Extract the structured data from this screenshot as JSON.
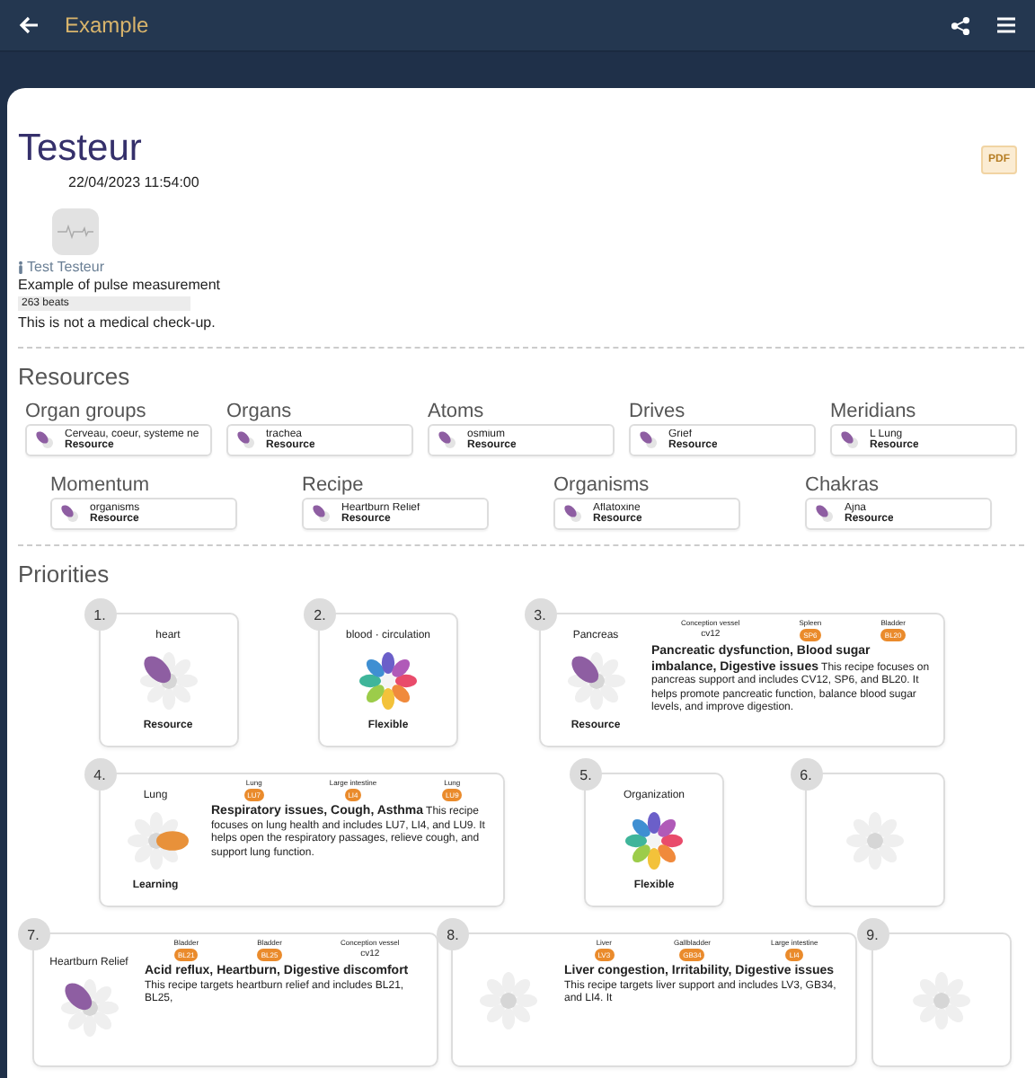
{
  "app_bar": {
    "title": "Example"
  },
  "report": {
    "title": "Testeur",
    "pdf_label": "PDF",
    "date": "22/04/2023 11:54:00",
    "person": "Test Testeur",
    "description": "Example of pulse measurement",
    "reading": "263 beats",
    "disclaimer": "This is not a medical check-up."
  },
  "resources": {
    "heading": "Resources",
    "groups": [
      {
        "name": "Organ groups",
        "item": "Cerveau, coeur, systeme ne",
        "type": "Resource"
      },
      {
        "name": "Organs",
        "item": "trachea",
        "type": "Resource"
      },
      {
        "name": "Atoms",
        "item": "osmium",
        "type": "Resource"
      },
      {
        "name": "Drives",
        "item": "Grief",
        "type": "Resource"
      },
      {
        "name": "Meridians",
        "item": "L Lung",
        "type": "Resource"
      },
      {
        "name": "Momentum",
        "item": "organisms",
        "type": "Resource"
      },
      {
        "name": "Recipe",
        "item": "Heartburn Relief",
        "type": "Resource"
      },
      {
        "name": "Organisms",
        "item": "Aflatoxine",
        "type": "Resource"
      },
      {
        "name": "Chakras",
        "item": "Ajna",
        "type": "Resource"
      }
    ]
  },
  "priorities": {
    "heading": "Priorities",
    "items": [
      {
        "number": "1.",
        "kind": "simple",
        "label": "heart",
        "type": "Resource",
        "flower": {
          "kind": "corner",
          "color": "#8e5ea2"
        }
      },
      {
        "number": "2.",
        "kind": "simple",
        "label": "blood · circulation",
        "type": "Flexible",
        "flower": {
          "kind": "rainbow"
        }
      },
      {
        "number": "3.",
        "kind": "recipe",
        "label": "Pancreas",
        "type": "Resource",
        "flower": {
          "kind": "corner",
          "color": "#8e5ea2"
        },
        "points": [
          {
            "kind": "plain",
            "meridian": "Conception vessel",
            "code": "cv12"
          },
          {
            "kind": "badge",
            "meridian": "Spleen",
            "code": "SP6"
          },
          {
            "kind": "badge",
            "meridian": "Bladder",
            "code": "BL20"
          }
        ],
        "text": "**Pancreatic dysfunction, Blood sugar imbalance, Digestive issues** This recipe focuses on pancreas support and includes CV12, SP6, and BL20. It helps promote pancreatic function, balance blood sugar levels, and improve digestion."
      },
      {
        "number": "4.",
        "kind": "recipe",
        "label": "Lung",
        "type": "Learning",
        "flower": {
          "kind": "side",
          "color": "#e8913a"
        },
        "points": [
          {
            "kind": "badge",
            "meridian": "Lung",
            "code": "LU7"
          },
          {
            "kind": "badge",
            "meridian": "Large intestine",
            "code": "LI4"
          },
          {
            "kind": "badge",
            "meridian": "Lung",
            "code": "LU9"
          }
        ],
        "text": "**Respiratory issues, Cough, Asthma** This recipe focuses on lung health and includes LU7, LI4, and LU9. It helps open the respiratory passages, relieve cough, and support lung function."
      },
      {
        "number": "5.",
        "kind": "simple",
        "label": "Organization",
        "type": "Flexible",
        "flower": {
          "kind": "rainbow"
        }
      },
      {
        "number": "6.",
        "kind": "simple",
        "flower": {
          "kind": "blank"
        }
      },
      {
        "number": "7.",
        "kind": "recipe",
        "label": "Heartburn Relief",
        "flower": {
          "kind": "corner",
          "color": "#8e5ea2"
        },
        "points": [
          {
            "kind": "badge",
            "meridian": "Bladder",
            "code": "BL21"
          },
          {
            "kind": "badge",
            "meridian": "Bladder",
            "code": "BL25"
          },
          {
            "kind": "plain",
            "meridian": "Conception vessel",
            "code": "cv12"
          }
        ],
        "text": "**Acid reflux, Heartburn, Digestive discomfort** This recipe targets heartburn relief and includes BL21, BL25,"
      },
      {
        "number": "8.",
        "kind": "recipe",
        "flower": {
          "kind": "blank"
        },
        "points": [
          {
            "kind": "badge",
            "meridian": "Liver",
            "code": "LV3"
          },
          {
            "kind": "badge",
            "meridian": "Gallbladder",
            "code": "GB34"
          },
          {
            "kind": "badge",
            "meridian": "Large intestine",
            "code": "LI4"
          }
        ],
        "text": "**Liver congestion, Irritability, Digestive issues** This recipe targets liver support and includes LV3, GB34, and LI4. It"
      },
      {
        "number": "9.",
        "kind": "simple",
        "flower": {
          "kind": "blank"
        }
      }
    ]
  }
}
